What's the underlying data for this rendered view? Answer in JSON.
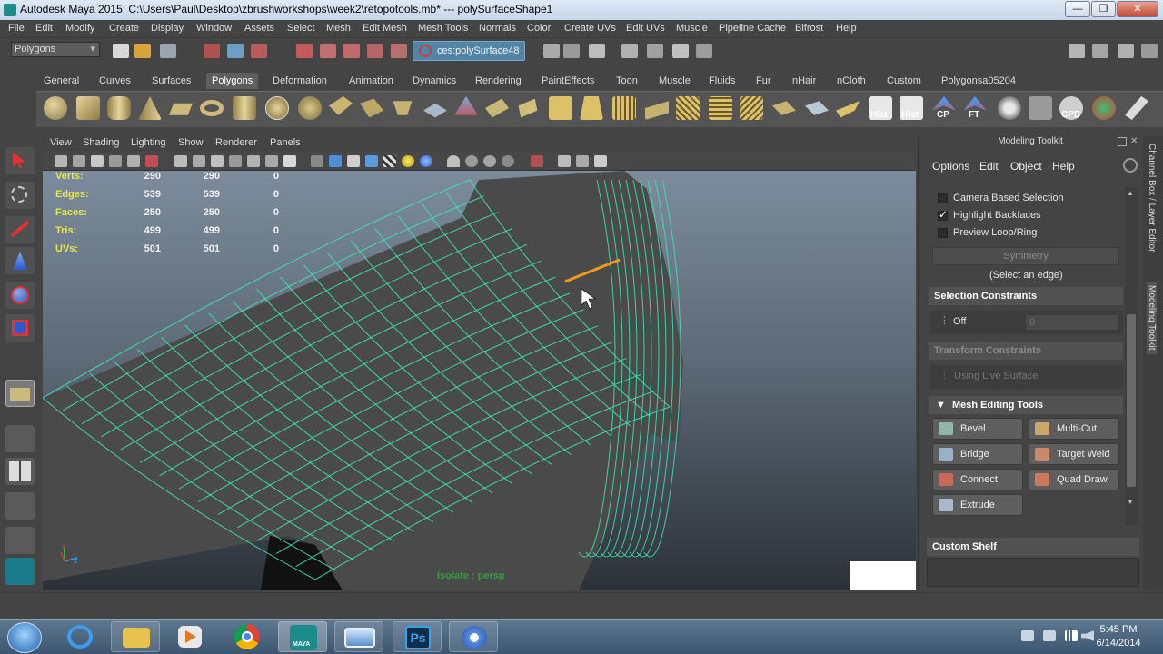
{
  "window": {
    "title": "Autodesk Maya 2015: C:\\Users\\Paul\\Desktop\\zbrushworkshops\\week2\\retopotools.mb*   ---   polySurfaceShape1",
    "controls": [
      "—",
      "❐",
      "✕"
    ]
  },
  "menubar": [
    "File",
    "Edit",
    "Modify",
    "Create",
    "Display",
    "Window",
    "Assets",
    "Select",
    "Mesh",
    "Edit Mesh",
    "Mesh Tools",
    "Normals",
    "Color",
    "Create UVs",
    "Edit UVs",
    "Muscle",
    "Pipeline Cache",
    "Bifrost",
    "Help"
  ],
  "statusline": {
    "mode": "Polygons",
    "selection_field": "ces:polySurface48"
  },
  "shelf": {
    "tabs": [
      "General",
      "Curves",
      "Surfaces",
      "Polygons",
      "Deformation",
      "Animation",
      "Dynamics",
      "Rendering",
      "PaintEffects",
      "Toon",
      "Muscle",
      "Fluids",
      "Fur",
      "nHair",
      "nCloth",
      "Custom",
      "Polygonsa05204"
    ],
    "active_tab": "Polygons",
    "labeled_icons": [
      "Hist",
      "Hist",
      "CP",
      "FT",
      "CPD"
    ]
  },
  "viewport": {
    "menu": [
      "View",
      "Shading",
      "Lighting",
      "Show",
      "Renderer",
      "Panels"
    ],
    "hud": [
      {
        "label": "Verts:",
        "v1": "290",
        "v2": "290",
        "v3": "0"
      },
      {
        "label": "Edges:",
        "v1": "539",
        "v2": "539",
        "v3": "0"
      },
      {
        "label": "Faces:",
        "v1": "250",
        "v2": "250",
        "v3": "0"
      },
      {
        "label": "Tris:",
        "v1": "499",
        "v2": "499",
        "v3": "0"
      },
      {
        "label": "UVs:",
        "v1": "501",
        "v2": "501",
        "v3": "0"
      }
    ],
    "isolate_label": "Isolate : persp",
    "axis_x": "x",
    "axis_z": "z",
    "wire_color": "#3de6b4",
    "selected_edge_color": "#f29a1c"
  },
  "toolkit": {
    "title": "Modeling Toolkit",
    "menu": [
      "Options",
      "Edit",
      "Object",
      "Help"
    ],
    "options": [
      {
        "label": "Camera Based Selection",
        "checked": false
      },
      {
        "label": "Highlight Backfaces",
        "checked": true
      },
      {
        "label": "Preview Loop/Ring",
        "checked": false
      }
    ],
    "symmetry_button": "Symmetry",
    "symmetry_hint": "(Select an edge)",
    "selection_constraints": {
      "header": "Selection Constraints",
      "value": "Off",
      "num": "0"
    },
    "transform_constraints": {
      "header": "Transform Constraints",
      "value": "Using Live Surface"
    },
    "mesh_editing": {
      "header": "Mesh Editing Tools",
      "buttons": [
        "Bevel",
        "Multi-Cut",
        "Bridge",
        "Target Weld",
        "Connect",
        "Quad Draw",
        "Extrude"
      ]
    },
    "custom_shelf": "Custom Shelf"
  },
  "side_tabs": [
    "Channel Box / Layer Editor",
    "Modeling Toolkit"
  ],
  "taskbar": {
    "time": "5:45 PM",
    "date": "6/14/2014",
    "maya_label": "MAYA"
  }
}
